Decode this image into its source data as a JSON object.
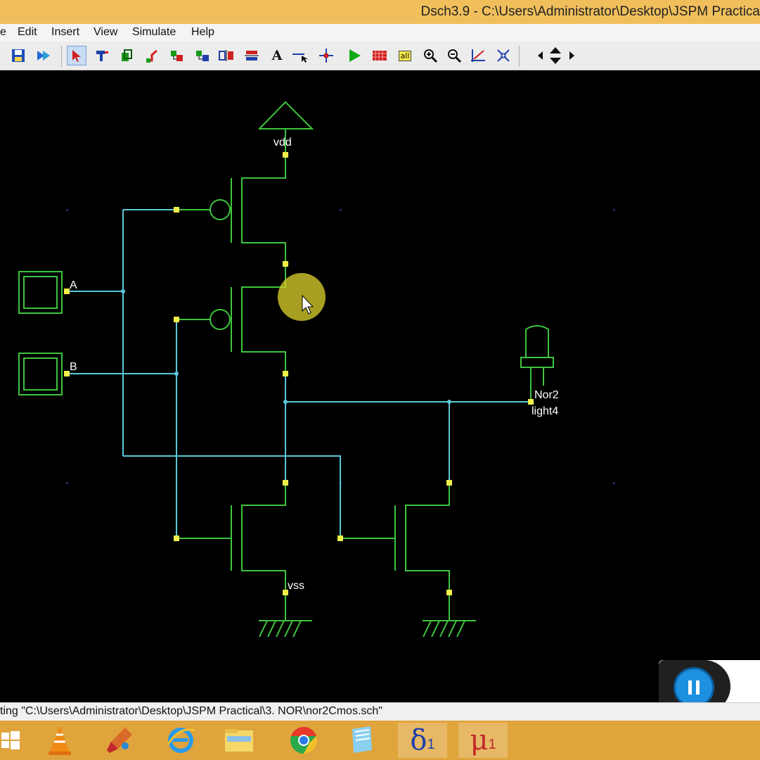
{
  "window": {
    "title": "Dsch3.9 - C:\\Users\\Administrator\\Desktop\\JSPM Practica"
  },
  "menu": [
    "e",
    "Edit",
    "Insert",
    "View",
    "Simulate",
    "Help"
  ],
  "toolbar": {
    "tools": [
      "save-icon",
      "run-icon",
      "select-pointer-icon",
      "connect-icon",
      "component-icon",
      "line-icon",
      "mosfet-icon",
      "nmos-icon",
      "pmos-icon",
      "align-icon",
      "text-icon",
      "probe-icon",
      "junction-icon",
      "simulate-play-icon",
      "timing-icon",
      "all-icon",
      "zoom-in-icon",
      "zoom-out-icon",
      "measure-icon",
      "fit-icon",
      "arrow-left-icon",
      "arrow-updown-icon",
      "arrow-right-icon"
    ],
    "text_tool_glyph": "A",
    "all_tool_glyph": "all"
  },
  "schematic": {
    "labels": {
      "vdd": "vdd",
      "vss": "vss",
      "input_a": "A",
      "input_b": "B",
      "output_name": "Nor2",
      "output_light": "light4"
    },
    "colors": {
      "wire": "#5cc8d8",
      "component": "#3ec43e",
      "node": "#f0f04a",
      "background": "#000000",
      "grid_dot": "#1c2c6e"
    }
  },
  "status": {
    "text": "ting \"C:\\Users\\Administrator\\Desktop\\JSPM Practical\\3. NOR\\nor2Cmos.sch\""
  },
  "player": {
    "pause_icon": "pause-icon"
  },
  "taskbar": {
    "apps": [
      "windows-start-icon",
      "vlc-icon",
      "paint-icon",
      "internet-explorer-icon",
      "file-explorer-icon",
      "chrome-icon",
      "notepad-icon",
      "dsch-icon",
      "microwind-icon"
    ],
    "dsch_glyph": "δ",
    "microwind_glyph": "μ",
    "app_suffix": "1"
  }
}
